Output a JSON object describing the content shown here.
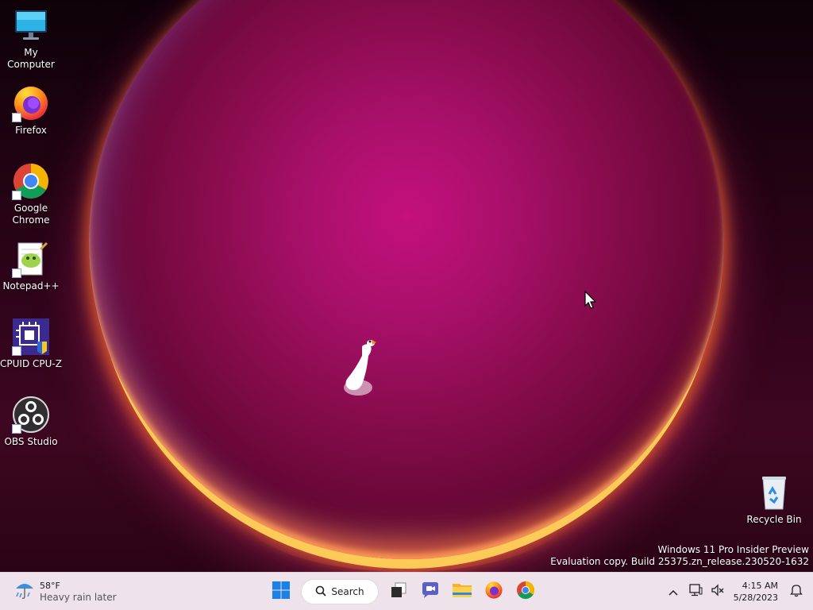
{
  "desktop": {
    "icons": [
      {
        "label": "My Computer",
        "icon": "monitor-icon"
      },
      {
        "label": "Firefox",
        "icon": "firefox-icon"
      },
      {
        "label": "Google Chrome",
        "icon": "chrome-icon"
      },
      {
        "label": "Notepad++",
        "icon": "notepadpp-icon"
      },
      {
        "label": "CPUID CPU-Z",
        "icon": "cpuz-icon"
      },
      {
        "label": "OBS Studio",
        "icon": "obs-icon"
      },
      {
        "label": "Recycle Bin",
        "icon": "recycle-bin-icon"
      }
    ]
  },
  "watermark": {
    "line1": "Windows 11 Pro Insider Preview",
    "line2": "Evaluation copy. Build 25375.zn_release.230520-1632"
  },
  "taskbar": {
    "weather": {
      "temp": "58°F",
      "desc": "Heavy rain later",
      "icon": "rain-umbrella-icon"
    },
    "start_icon": "windows-start-icon",
    "search_label": "Search",
    "apps": [
      "task-view-icon",
      "teams-chat-icon",
      "file-explorer-icon",
      "firefox-icon",
      "chrome-icon"
    ],
    "tray": {
      "chevron_icon": "show-hidden-icons-icon",
      "network_icon": "network-icon",
      "volume_icon": "volume-muted-icon",
      "time": "4:15 AM",
      "date": "5/28/2023",
      "notification_icon": "notification-icon"
    }
  },
  "colors": {
    "taskbar_bg": "#eee3ea",
    "start_blue": "#1a82e6",
    "wallpaper_orb": "#c4107c"
  }
}
